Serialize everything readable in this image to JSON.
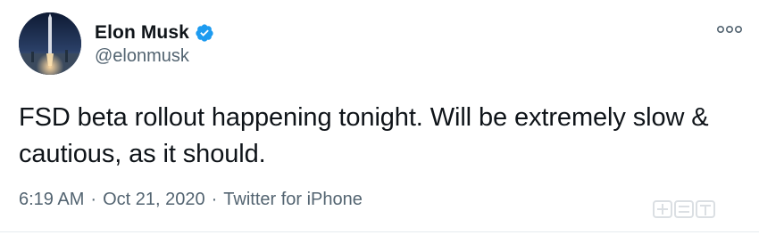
{
  "tweet": {
    "author": {
      "display_name": "Elon Musk",
      "handle": "@elonmusk",
      "verified": true,
      "avatar_icon": "rocket-launch-avatar"
    },
    "text": "FSD beta rollout happening tonight. Will be extremely slow & cautious, as it should.",
    "meta": {
      "time": "6:19 AM",
      "separator": "·",
      "date": "Oct 21, 2020",
      "source": "Twitter for iPhone"
    },
    "more_icon": "more-options-icon"
  },
  "colors": {
    "text_primary": "#0f1419",
    "text_secondary": "#536471",
    "verified_blue": "#1d9bf0"
  }
}
